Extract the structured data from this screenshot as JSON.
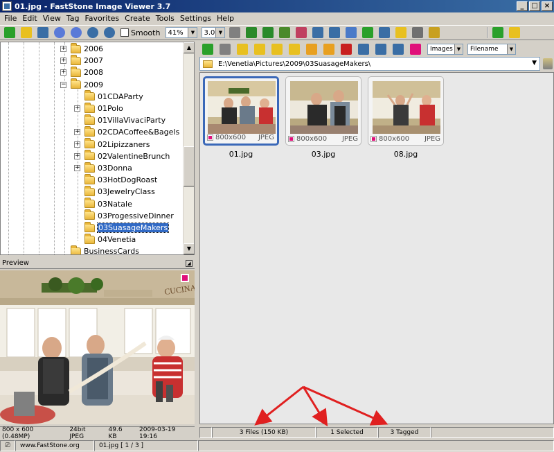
{
  "window": {
    "title": "01.jpg - FastStone Image Viewer 3.7",
    "minimize": "_",
    "maximize": "□",
    "close": "×"
  },
  "menu": [
    "File",
    "Edit",
    "View",
    "Tag",
    "Favorites",
    "Create",
    "Tools",
    "Settings",
    "Help"
  ],
  "toolbar": {
    "smooth_label": "Smooth",
    "zoom_value": "41%",
    "ratio_value": "3.0",
    "colors": [
      "#2aa02a",
      "#e8c020",
      "#3a6ea5",
      "#5a7ad8",
      "#5a7ad8",
      "#3a6ea5",
      "#3a6ea5",
      "#808080",
      "#2a8a2a",
      "#2a8a2a",
      "#4a8a2a",
      "#c04060",
      "#3a6ea5",
      "#3a6ea5",
      "#4a7ac8",
      "#2aa02a",
      "#3a6ea5",
      "#e8c020",
      "#707070",
      "#c8a020"
    ]
  },
  "tree": {
    "items": [
      {
        "label": "2006",
        "level": 0,
        "expander": "+"
      },
      {
        "label": "2007",
        "level": 0,
        "expander": "+"
      },
      {
        "label": "2008",
        "level": 0,
        "expander": "+"
      },
      {
        "label": "2009",
        "level": 0,
        "expander": "−"
      },
      {
        "label": "01CDAParty",
        "level": 1,
        "expander": ""
      },
      {
        "label": "01Polo",
        "level": 1,
        "expander": "+"
      },
      {
        "label": "01VillaVivaciParty",
        "level": 1,
        "expander": ""
      },
      {
        "label": "02CDACoffee&Bagels",
        "level": 1,
        "expander": "+"
      },
      {
        "label": "02Lipizzaners",
        "level": 1,
        "expander": "+"
      },
      {
        "label": "02ValentineBrunch",
        "level": 1,
        "expander": "+"
      },
      {
        "label": "03Donna",
        "level": 1,
        "expander": "+"
      },
      {
        "label": "03HotDogRoast",
        "level": 1,
        "expander": ""
      },
      {
        "label": "03JewelryClass",
        "level": 1,
        "expander": ""
      },
      {
        "label": "03Natale",
        "level": 1,
        "expander": ""
      },
      {
        "label": "03ProgessiveDinner",
        "level": 1,
        "expander": ""
      },
      {
        "label": "03SuasageMakers",
        "level": 1,
        "expander": "",
        "selected": true
      },
      {
        "label": "04Venetia",
        "level": 1,
        "expander": ""
      },
      {
        "label": "BusinessCards",
        "level": 0,
        "expander": ""
      }
    ]
  },
  "preview": {
    "header": "Preview",
    "info_size": "800 x 600 (0.48MP)",
    "info_depth": "24bit JPEG",
    "info_filesize": "49.6 KB",
    "info_date": "2009-03-19 19:16"
  },
  "browser": {
    "filter": "Images",
    "sort": "Filename",
    "path": "E:\\Venetia\\Pictures\\2009\\03SuasageMakers\\",
    "thumbnails": [
      {
        "name": "01.jpg",
        "dims": "800x600",
        "format": "JPEG",
        "selected": true
      },
      {
        "name": "03.jpg",
        "dims": "800x600",
        "format": "JPEG",
        "selected": false
      },
      {
        "name": "08.jpg",
        "dims": "800x600",
        "format": "JPEG",
        "selected": false
      }
    ],
    "toolbar_colors": [
      "#2aa02a",
      "#808080",
      "#e8c020",
      "#e8c020",
      "#e8c020",
      "#e8c020",
      "#e8a020",
      "#e8a020",
      "#c82020",
      "#3a6ea5",
      "#3a6ea5",
      "#3a6ea5",
      "#e0107a"
    ]
  },
  "status": {
    "files": "3 Files (150 KB)",
    "selected": "1 Selected",
    "tagged": "3 Tagged",
    "website": "www.FastStone.org",
    "position": "01.jpg [ 1 / 3 ]"
  }
}
